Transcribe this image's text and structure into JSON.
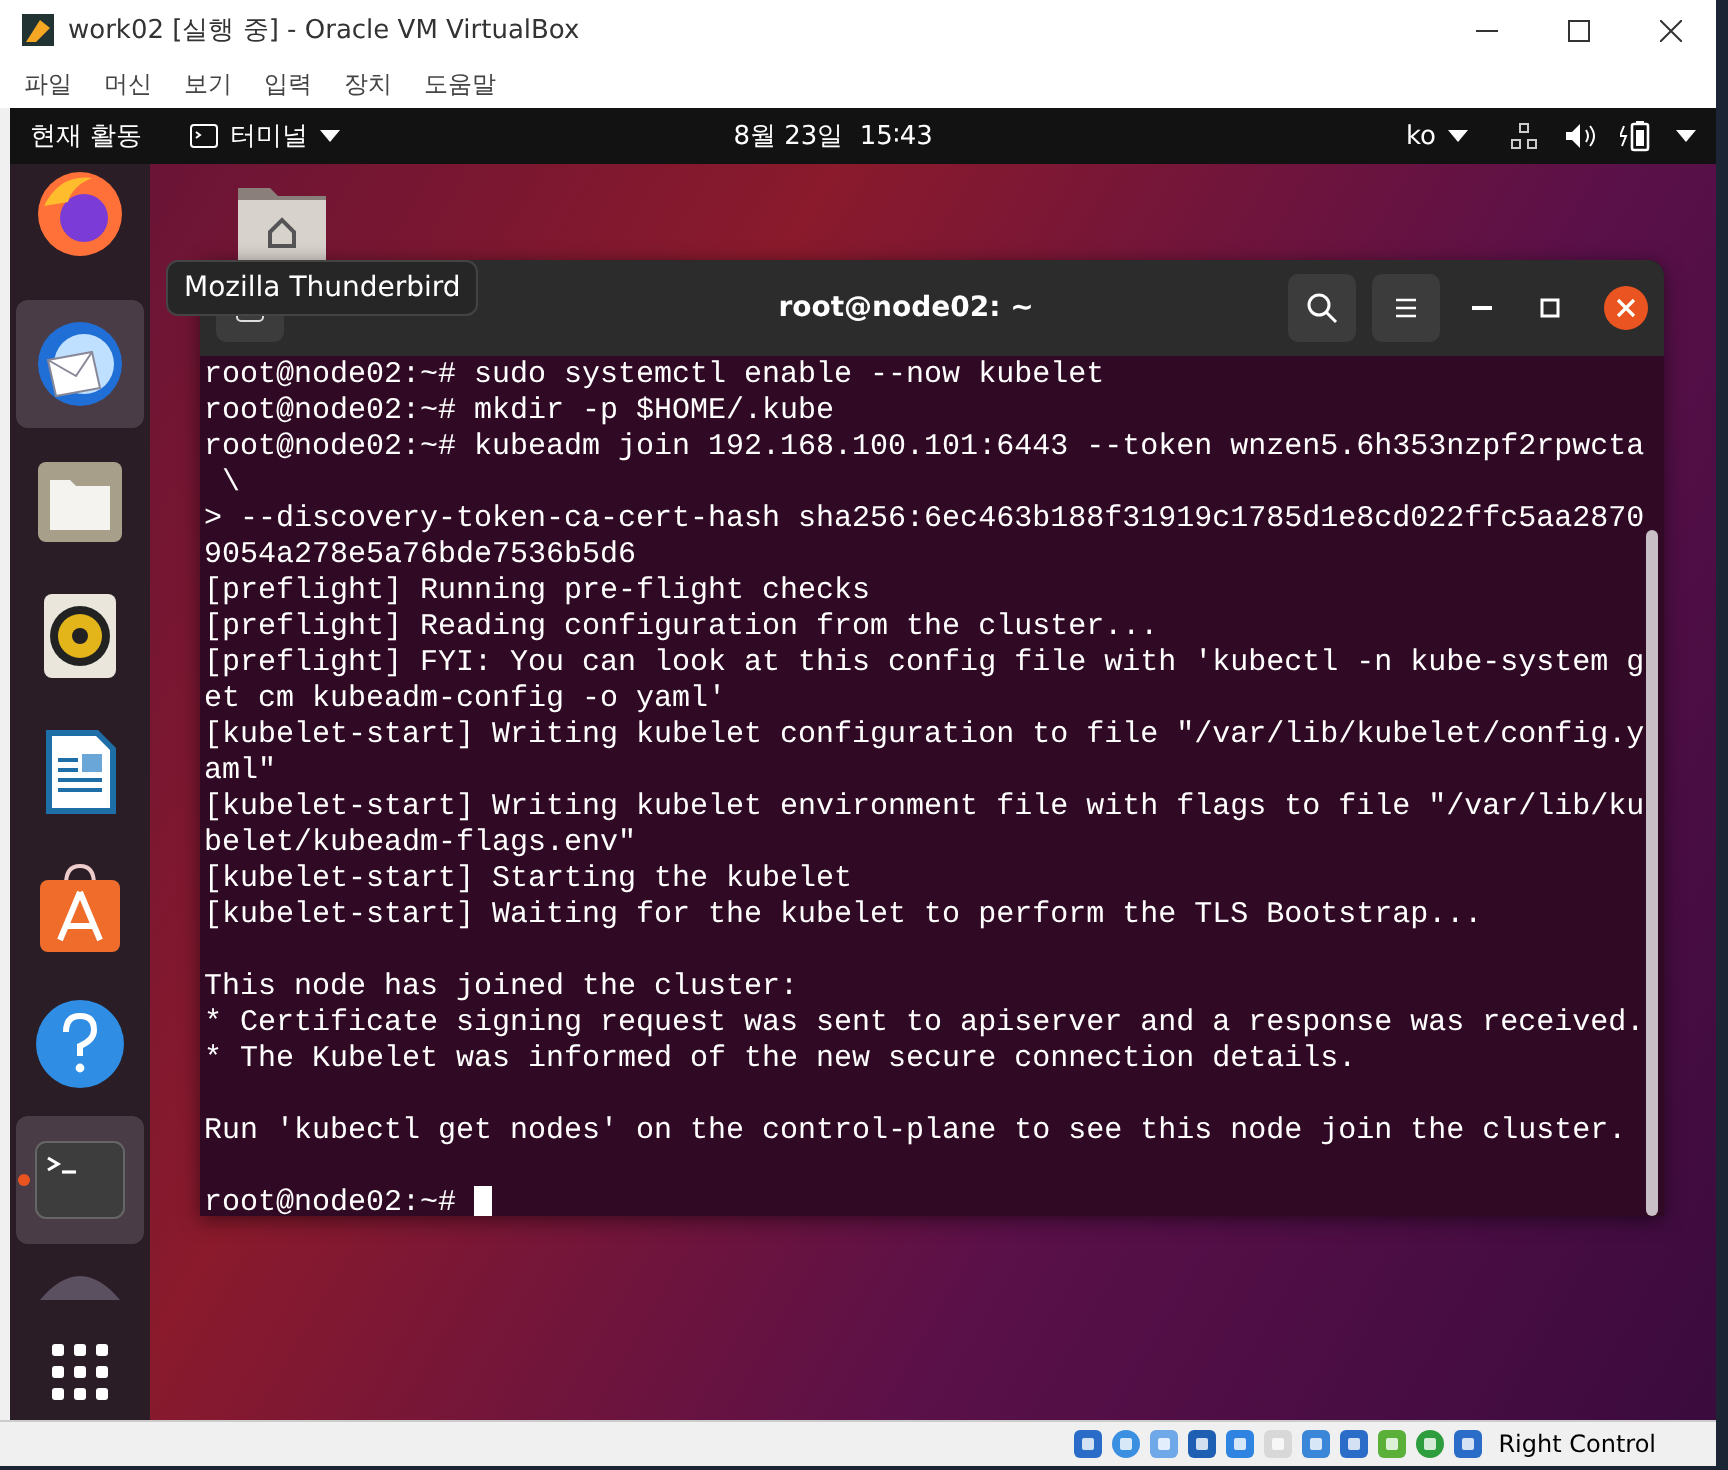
{
  "host_window": {
    "title": "work02 [실행 중] - Oracle VM VirtualBox",
    "menu": [
      "파일",
      "머신",
      "보기",
      "입력",
      "장치",
      "도움말"
    ],
    "host_key": "Right Control"
  },
  "top_bar": {
    "activities": "현재 활동",
    "app_menu": "터미널",
    "clock": "8월 23일  15∶43",
    "input_source": "ko"
  },
  "dock": {
    "items": [
      {
        "kind": "firefox",
        "highlighted": false,
        "running": false
      },
      {
        "kind": "thunderbird",
        "highlighted": true,
        "running": false
      },
      {
        "kind": "files",
        "highlighted": false,
        "running": false
      },
      {
        "kind": "rhythmbox",
        "highlighted": false,
        "running": false
      },
      {
        "kind": "writer",
        "highlighted": false,
        "running": false
      },
      {
        "kind": "software",
        "highlighted": false,
        "running": false
      },
      {
        "kind": "help",
        "highlighted": false,
        "running": false
      },
      {
        "kind": "terminal",
        "highlighted": true,
        "running": true
      },
      {
        "kind": "partial",
        "highlighted": false,
        "running": false
      },
      {
        "kind": "apps",
        "highlighted": false,
        "running": false
      }
    ]
  },
  "tooltip": "Mozilla Thunderbird",
  "terminal": {
    "title": "root@node02: ~",
    "cursor": true,
    "blocks": [
      [
        "root@node02:~# sudo systemctl enable --now kubelet",
        "root@node02:~# mkdir -p $HOME/.kube",
        "root@node02:~# kubeadm join 192.168.100.101:6443 --token wnzen5.6h353nzpf2rpwcta",
        " \\",
        "> --discovery-token-ca-cert-hash sha256:6ec463b188f31919c1785d1e8cd022ffc5aa2870",
        "9054a278e5a76bde7536b5d6",
        "[preflight] Running pre-flight checks",
        "[preflight] Reading configuration from the cluster...",
        "[preflight] FYI: You can look at this config file with 'kubectl -n kube-system g",
        "et cm kubeadm-config -o yaml'",
        "[kubelet-start] Writing kubelet configuration to file \"/var/lib/kubelet/config.y",
        "aml\"",
        "[kubelet-start] Writing kubelet environment file with flags to file \"/var/lib/ku",
        "belet/kubeadm-flags.env\"",
        "[kubelet-start] Starting the kubelet",
        "[kubelet-start] Waiting for the kubelet to perform the TLS Bootstrap..."
      ],
      [
        "This node has joined the cluster:",
        "* Certificate signing request was sent to apiserver and a response was received.",
        "* The Kubelet was informed of the new secure connection details."
      ],
      [
        "Run 'kubectl get nodes' on the control-plane to see this node join the cluster."
      ],
      [
        "root@node02:~# "
      ]
    ]
  }
}
